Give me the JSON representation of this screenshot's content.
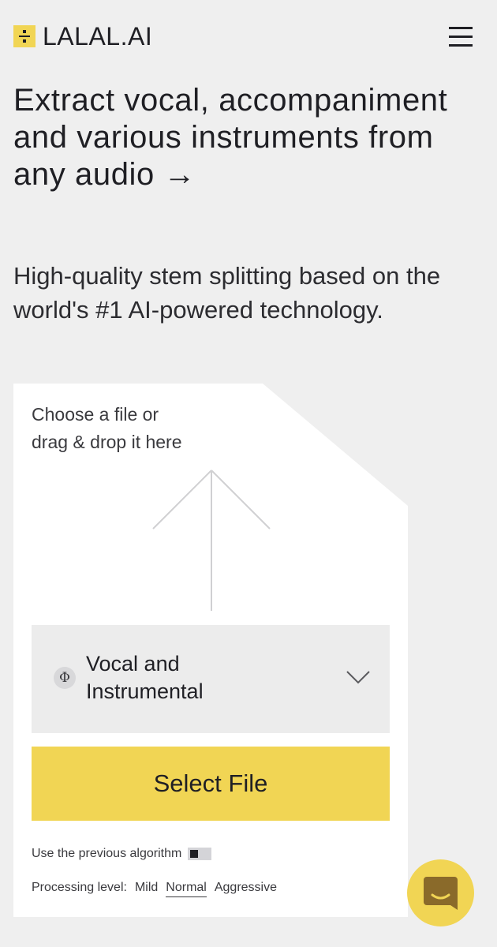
{
  "header": {
    "logo_text": "LALAL.AI",
    "menu_icon": "hamburger-menu-icon"
  },
  "hero": {
    "headline": "Extract vocal, accompaniment and various instruments from any audio →",
    "subheadline": "High-quality stem splitting based on the world's #1 AI-powered technology."
  },
  "uploader": {
    "drop_line1": "Choose a file or",
    "drop_line2": "drag & drop it here",
    "stem_icon_glyph": "Φ",
    "stem_select": {
      "line1": "Vocal and",
      "line2": "Instrumental"
    },
    "select_button": "Select File",
    "previous_algorithm_label": "Use the previous algorithm",
    "processing_level": {
      "label": "Processing level:",
      "options": [
        "Mild",
        "Normal",
        "Aggressive"
      ],
      "selected": "Normal"
    }
  },
  "colors": {
    "accent": "#f1d554",
    "background": "#efefef",
    "text": "#1f1f24"
  }
}
